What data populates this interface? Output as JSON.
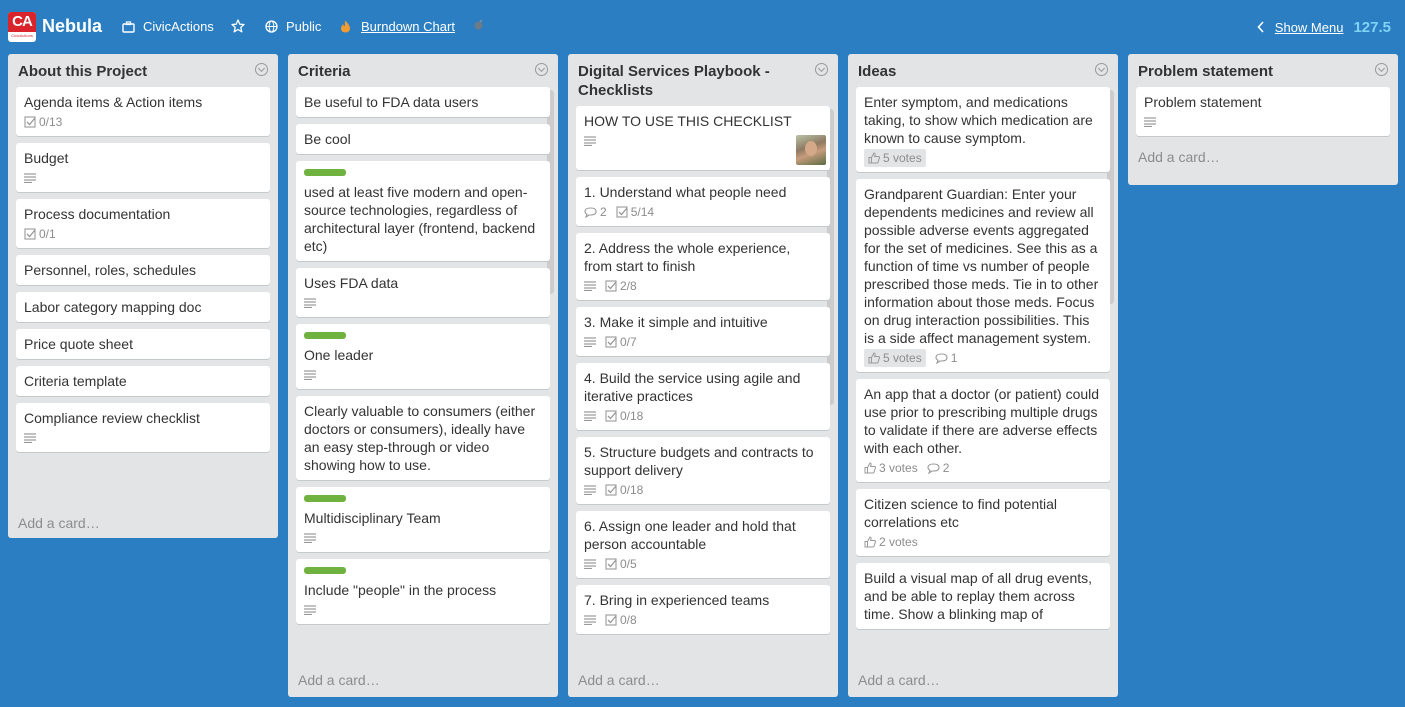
{
  "header": {
    "logo_text": "CA",
    "logo_subtext": "CivicActions",
    "board_name": "Nebula",
    "team": "CivicActions",
    "visibility": "Public",
    "powerup": "Burndown Chart",
    "show_menu": "Show Menu",
    "counter": "127.5"
  },
  "lists": [
    {
      "title": "About this Project",
      "add_card": "Add a card…",
      "cards": [
        {
          "text": "Agenda items & Action items",
          "checklist": "0/13"
        },
        {
          "text": "Budget",
          "desc": true
        },
        {
          "text": "Process documentation",
          "checklist": "0/1"
        },
        {
          "text": "Personnel, roles, schedules"
        },
        {
          "text": "Labor category mapping doc"
        },
        {
          "text": "Price quote sheet"
        },
        {
          "text": "Criteria template"
        },
        {
          "text": "Compliance review checklist",
          "desc": true
        }
      ]
    },
    {
      "title": "Criteria",
      "add_card": "Add a card…",
      "cards": [
        {
          "text": "Be useful to FDA data users"
        },
        {
          "text": "Be cool"
        },
        {
          "text": "used at least five modern and open-source technologies, regardless of architectural layer (frontend, backend etc)",
          "label": true
        },
        {
          "text": "Uses FDA data",
          "desc": true
        },
        {
          "text": "One leader",
          "label": true,
          "desc": true
        },
        {
          "text": "Clearly valuable to consumers (either doctors or consumers), ideally have an easy step-through or video showing how to use."
        },
        {
          "text": "Multidisciplinary Team",
          "label": true,
          "desc": true
        },
        {
          "text": "Include \"people\" in the process",
          "label": true,
          "desc": true
        }
      ]
    },
    {
      "title": "Digital Services Playbook - Checklists",
      "add_card": "Add a card…",
      "cards": [
        {
          "text": "HOW TO USE THIS CHECKLIST",
          "desc": true,
          "avatar": true
        },
        {
          "text": "1. Understand what people need",
          "comments": "2",
          "checklist": "5/14"
        },
        {
          "text": "2. Address the whole experience, from start to finish",
          "desc": true,
          "checklist": "2/8"
        },
        {
          "text": "3. Make it simple and intuitive",
          "desc": true,
          "checklist": "0/7"
        },
        {
          "text": "4. Build the service using agile and iterative practices",
          "desc": true,
          "checklist": "0/18"
        },
        {
          "text": "5. Structure budgets and contracts to support delivery",
          "desc": true,
          "checklist": "0/18"
        },
        {
          "text": "6. Assign one leader and hold that person accountable",
          "desc": true,
          "checklist": "0/5"
        },
        {
          "text": "7. Bring in experienced teams",
          "desc": true,
          "checklist": "0/8"
        }
      ]
    },
    {
      "title": "Ideas",
      "add_card": "Add a card…",
      "cards": [
        {
          "text": "Enter symptom, and medications taking, to show which medication are known to cause symptom.",
          "votes": "5 votes",
          "voted": true
        },
        {
          "text": "Grandparent Guardian: Enter your dependents medicines and review all possible adverse events aggregated for the set of medicines. See this as a function of time vs number of people prescribed those meds. Tie in to other information about those meds. Focus on drug interaction possibilities. This is a side affect management system.",
          "votes": "5 votes",
          "voted": true,
          "comments": "1"
        },
        {
          "text": "An app that a doctor (or patient) could use prior to prescribing multiple drugs to validate if there are adverse effects with each other.",
          "votes": "3 votes",
          "comments": "2"
        },
        {
          "text": "Citizen science to find potential correlations etc",
          "votes": "2 votes"
        },
        {
          "text": "Build a visual map of all drug events, and be able to replay them across time. Show a blinking map of"
        }
      ]
    },
    {
      "title": "Problem statement",
      "add_card": "Add a card…",
      "cards": [
        {
          "text": "Problem statement",
          "desc": true
        }
      ]
    }
  ]
}
